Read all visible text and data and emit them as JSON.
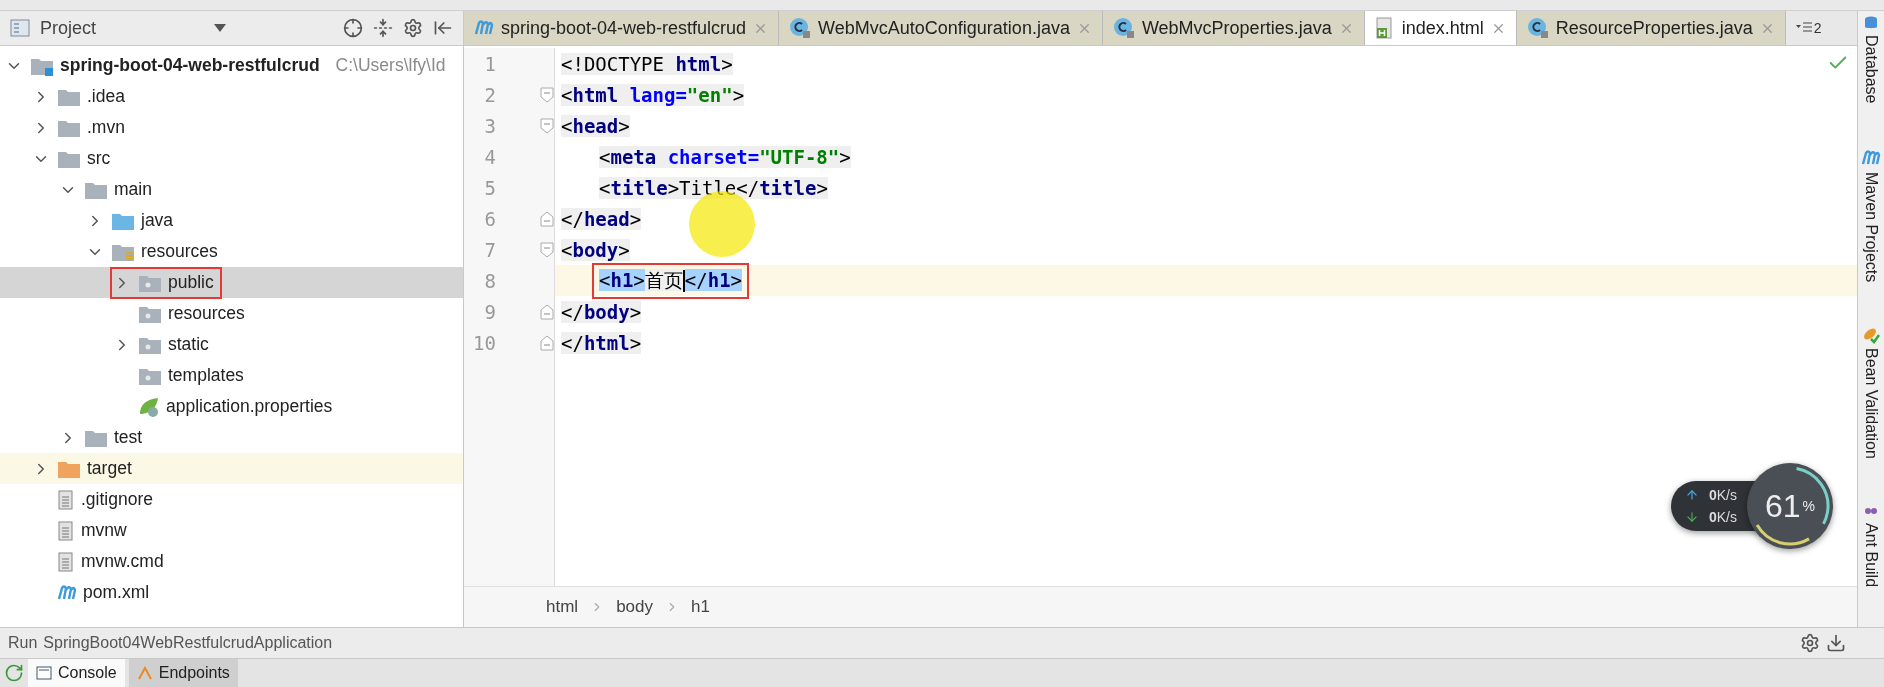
{
  "project_panel": {
    "title": "Project",
    "tree": [
      {
        "label": "spring-boot-04-web-restfulcrud",
        "path": "C:\\Users\\lfy\\Id",
        "kind": "module",
        "expanded": true,
        "selected": false,
        "children": [
          {
            "label": ".idea",
            "kind": "folder",
            "expanded": false,
            "selected": false
          },
          {
            "label": ".mvn",
            "kind": "folder",
            "expanded": false,
            "selected": false
          },
          {
            "label": "src",
            "kind": "folder",
            "expanded": true,
            "selected": false,
            "children": [
              {
                "label": "main",
                "kind": "folder",
                "expanded": true,
                "selected": false,
                "children": [
                  {
                    "label": "java",
                    "kind": "source",
                    "expanded": false,
                    "selected": false
                  },
                  {
                    "label": "resources",
                    "kind": "resources",
                    "expanded": true,
                    "selected": false,
                    "children": [
                      {
                        "label": "public",
                        "kind": "web",
                        "expanded": false,
                        "selected": true,
                        "boxed": true
                      },
                      {
                        "label": "resources",
                        "kind": "web",
                        "selected": false
                      },
                      {
                        "label": "static",
                        "kind": "web",
                        "expanded": false,
                        "selected": false
                      },
                      {
                        "label": "templates",
                        "kind": "web",
                        "selected": false
                      },
                      {
                        "label": "application.properties",
                        "kind": "spring",
                        "selected": false
                      }
                    ]
                  }
                ]
              },
              {
                "label": "test",
                "kind": "folder",
                "expanded": false,
                "selected": false
              }
            ]
          },
          {
            "label": "target",
            "kind": "excluded",
            "expanded": false,
            "selected": false
          },
          {
            "label": ".gitignore",
            "kind": "file",
            "selected": false
          },
          {
            "label": "mvnw",
            "kind": "file",
            "selected": false
          },
          {
            "label": "mvnw.cmd",
            "kind": "file",
            "selected": false
          },
          {
            "label": "pom.xml",
            "kind": "maven",
            "selected": false
          }
        ]
      }
    ]
  },
  "editor": {
    "tabs": [
      {
        "label": "spring-boot-04-web-restfulcrud",
        "kind": "maven",
        "selected": false
      },
      {
        "label": "WebMvcAutoConfiguration.java",
        "kind": "class",
        "selected": false
      },
      {
        "label": "WebMvcProperties.java",
        "kind": "class",
        "selected": false
      },
      {
        "label": "index.html",
        "kind": "html",
        "selected": true
      },
      {
        "label": "ResourceProperties.java",
        "kind": "class",
        "selected": false
      }
    ],
    "overflow_count": "2",
    "lines": [
      {
        "number": "1",
        "current": false,
        "tokens": [
          {
            "kind": "punct",
            "text": "<!DOCTYPE "
          },
          {
            "kind": "tag",
            "text": "html"
          },
          {
            "kind": "punct",
            "text": ">"
          }
        ]
      },
      {
        "number": "2",
        "fold_start": true,
        "current": false,
        "tokens": [
          {
            "kind": "punct",
            "text": "<"
          },
          {
            "kind": "tag",
            "text": "html "
          },
          {
            "kind": "attr",
            "text": "lang="
          },
          {
            "kind": "string",
            "text": "\"en\""
          },
          {
            "kind": "punct",
            "text": ">"
          }
        ]
      },
      {
        "number": "3",
        "fold_start": true,
        "current": false,
        "tokens": [
          {
            "kind": "punct",
            "text": "<"
          },
          {
            "kind": "tag",
            "text": "head"
          },
          {
            "kind": "punct",
            "text": ">"
          }
        ]
      },
      {
        "number": "4",
        "indented": true,
        "current": false,
        "tokens": [
          {
            "kind": "punct",
            "text": "<"
          },
          {
            "kind": "tag",
            "text": "meta "
          },
          {
            "kind": "attr",
            "text": "charset="
          },
          {
            "kind": "string",
            "text": "\"UTF-8\""
          },
          {
            "kind": "punct",
            "text": ">"
          }
        ]
      },
      {
        "number": "5",
        "indented": true,
        "current": false,
        "tokens": [
          {
            "kind": "punct",
            "text": "<"
          },
          {
            "kind": "tag",
            "text": "title"
          },
          {
            "kind": "punct",
            "text": ">Title</"
          },
          {
            "kind": "tag",
            "text": "title"
          },
          {
            "kind": "punct",
            "text": ">"
          }
        ]
      },
      {
        "number": "6",
        "fold_end": true,
        "current": false,
        "tokens": [
          {
            "kind": "punct",
            "text": "</"
          },
          {
            "kind": "tag",
            "text": "head"
          },
          {
            "kind": "punct",
            "text": ">"
          }
        ]
      },
      {
        "number": "7",
        "fold_start": true,
        "current": false,
        "tokens": [
          {
            "kind": "punct",
            "text": "<"
          },
          {
            "kind": "tag",
            "text": "body"
          },
          {
            "kind": "punct",
            "text": ">"
          }
        ]
      },
      {
        "number": "8",
        "indented": true,
        "current": true,
        "boxed": true,
        "tokens": [
          {
            "kind": "punct",
            "text": "<",
            "highlighted": true
          },
          {
            "kind": "tag",
            "text": "h1",
            "highlighted": true
          },
          {
            "kind": "punct",
            "text": ">",
            "highlighted": true
          },
          {
            "kind": "punct",
            "text": "首页",
            "caret_after": true
          },
          {
            "kind": "punct",
            "text": "</",
            "highlighted": true
          },
          {
            "kind": "tag",
            "text": "h1",
            "highlighted": true
          },
          {
            "kind": "punct",
            "text": ">",
            "highlighted": true
          }
        ]
      },
      {
        "number": "9",
        "fold_end": true,
        "current": false,
        "tokens": [
          {
            "kind": "punct",
            "text": "</"
          },
          {
            "kind": "tag",
            "text": "body"
          },
          {
            "kind": "punct",
            "text": ">"
          }
        ]
      },
      {
        "number": "10",
        "fold_end": true,
        "current": false,
        "tokens": [
          {
            "kind": "punct",
            "text": "</"
          },
          {
            "kind": "tag",
            "text": "html"
          },
          {
            "kind": "punct",
            "text": ">"
          }
        ]
      }
    ],
    "breadcrumbs": [
      "html",
      "body",
      "h1"
    ]
  },
  "right_stripe": [
    {
      "label": "Database",
      "kind": "database"
    },
    {
      "label": "Maven Projects",
      "kind": "maven"
    },
    {
      "label": "Bean Validation",
      "kind": "bean"
    },
    {
      "label": "Ant Build",
      "kind": "ant"
    }
  ],
  "network_widget": {
    "upload": "0",
    "upload_unit": "K/s",
    "download": "0",
    "download_unit": "K/s",
    "percent": "61",
    "percent_sign": "%"
  },
  "run_bar": {
    "label": "Run",
    "config": "SpringBoot04WebRestfulcrudApplication"
  },
  "bottom_tabs": [
    {
      "label": "Console",
      "selected": true
    },
    {
      "label": "Endpoints",
      "selected": false
    }
  ]
}
